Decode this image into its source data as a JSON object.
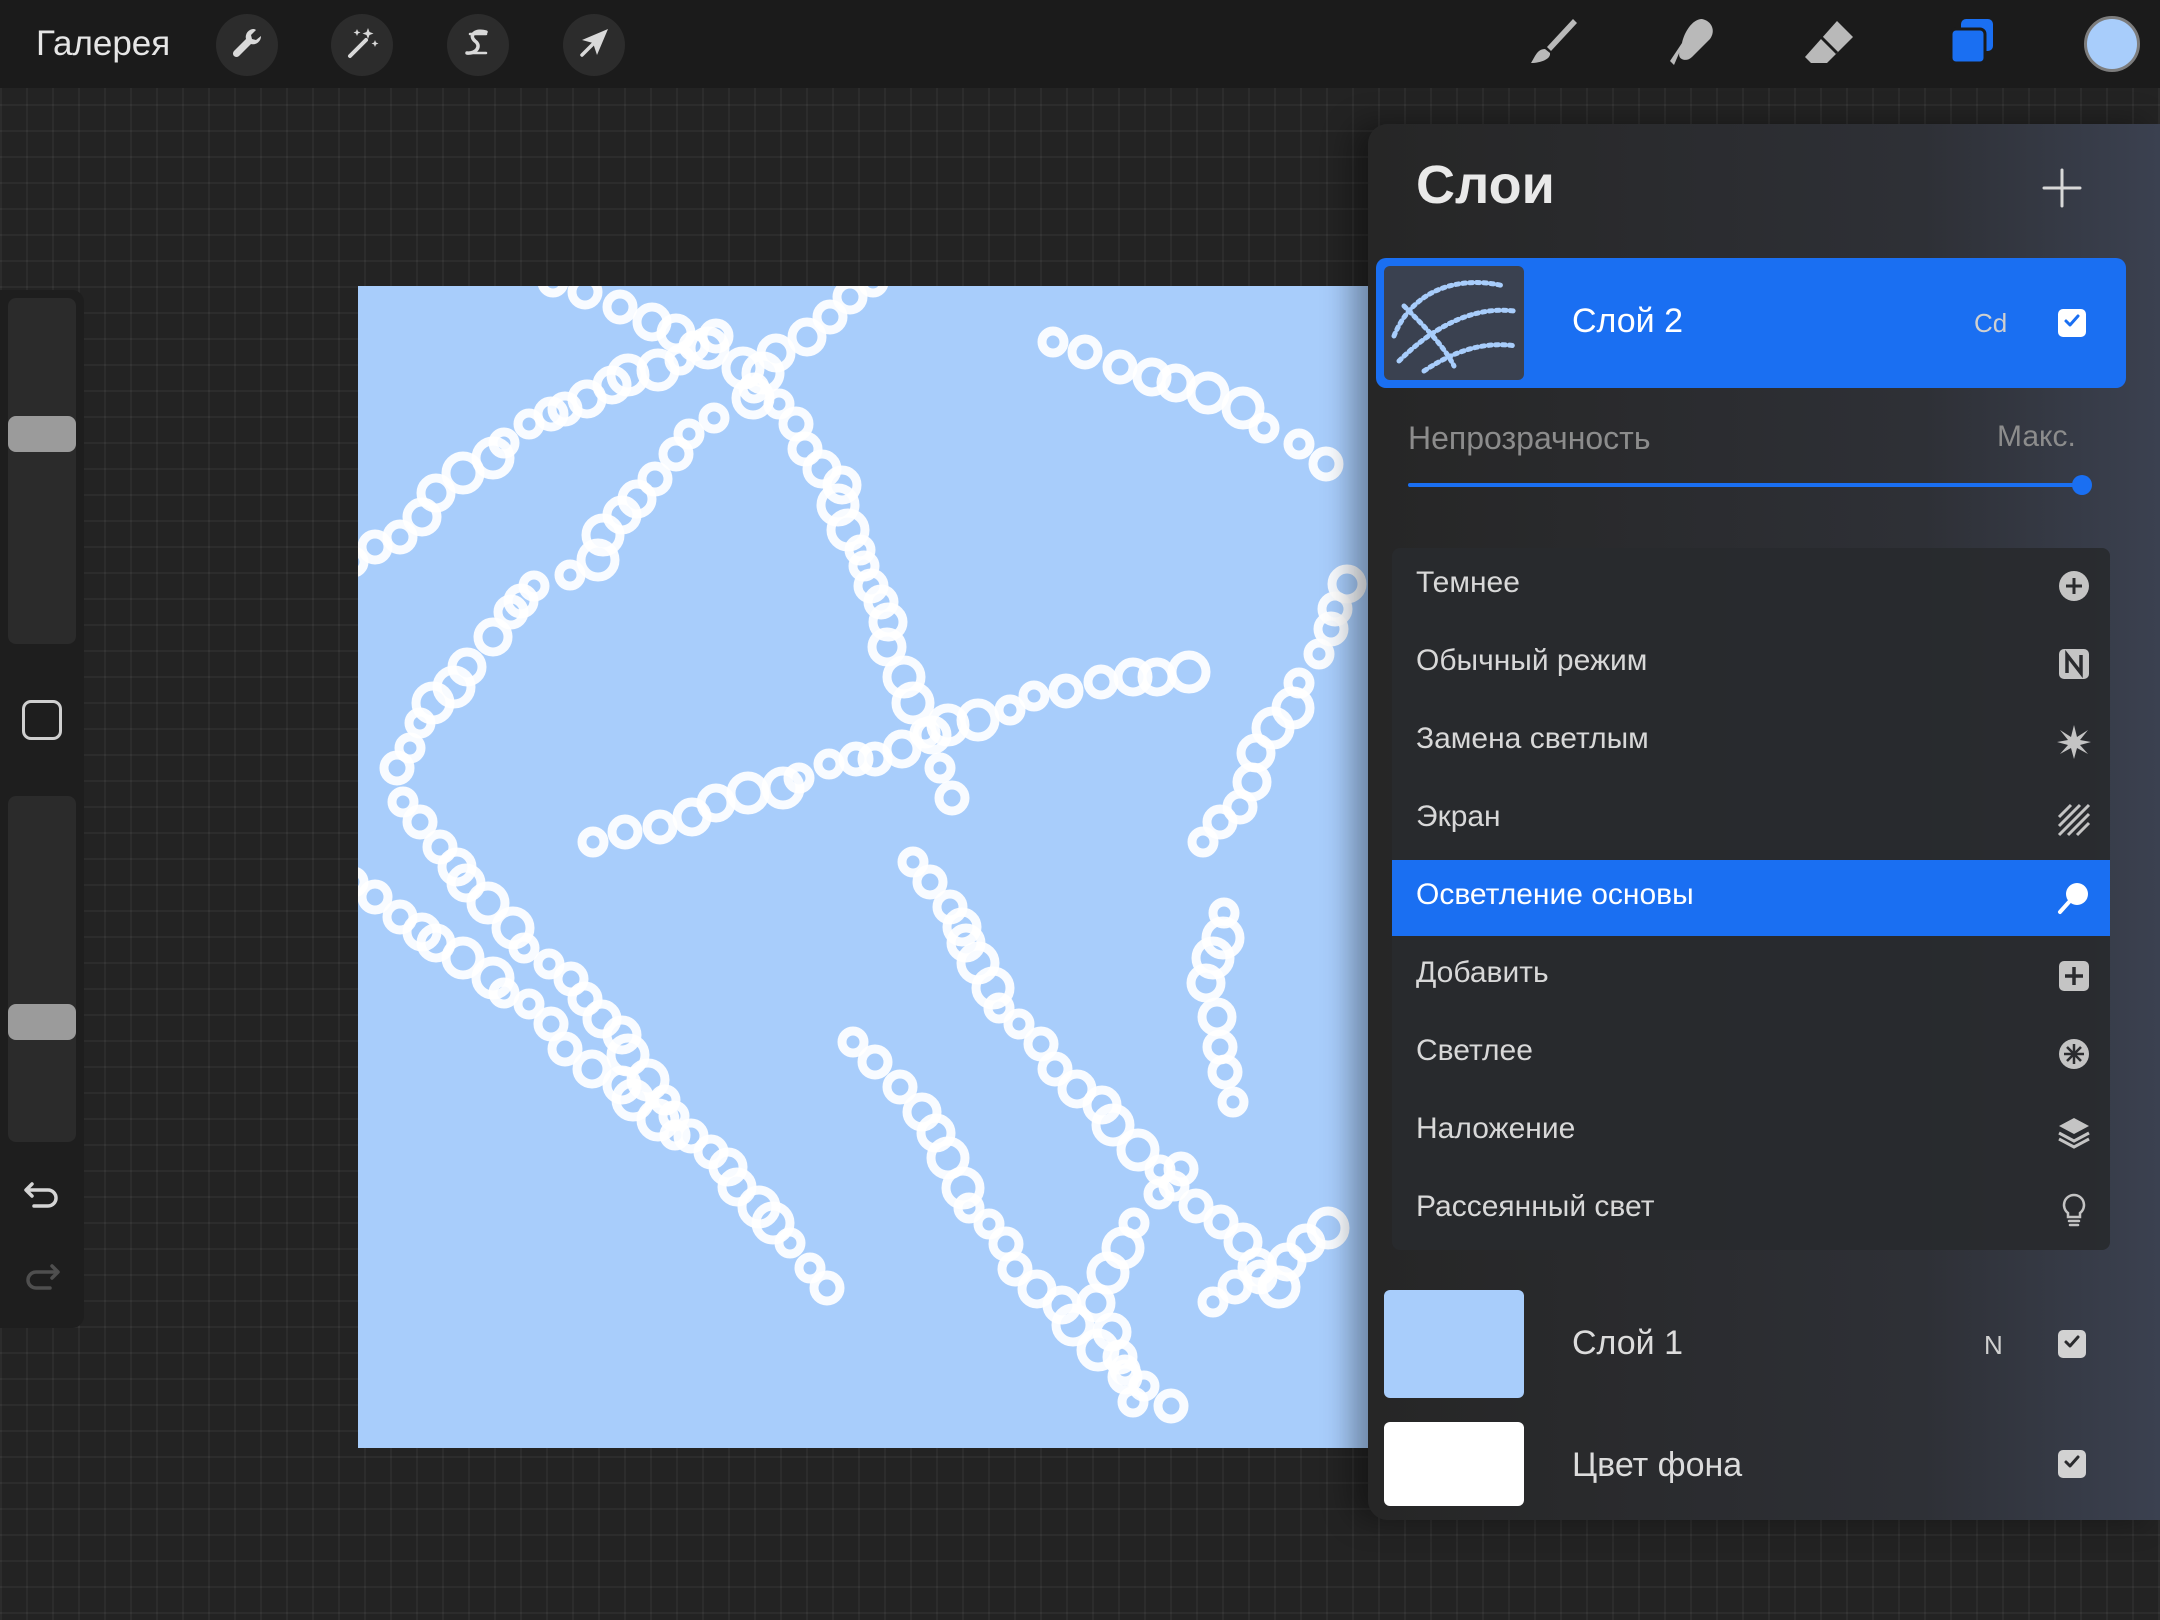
{
  "topbar": {
    "gallery_label": "Галерея",
    "left_tools": [
      {
        "name": "actions",
        "icon": "wrench-icon"
      },
      {
        "name": "adjustments",
        "icon": "magic-wand-icon"
      },
      {
        "name": "selection",
        "icon": "selection-s-icon"
      },
      {
        "name": "transform",
        "icon": "arrow-cursor-icon"
      }
    ],
    "right_tools": [
      {
        "name": "brush",
        "icon": "brush-icon"
      },
      {
        "name": "smudge",
        "icon": "smudge-finger-icon"
      },
      {
        "name": "eraser",
        "icon": "eraser-icon"
      },
      {
        "name": "layers",
        "icon": "layers-icon",
        "active": true
      }
    ],
    "current_color": "#a8cdfb"
  },
  "sidebar": {
    "brush_size_level": 0.62,
    "opacity_level": 0.33,
    "icons": [
      "modify-square-icon",
      "undo-icon",
      "redo-icon"
    ]
  },
  "canvas": {
    "background_color": "#a8cdfb",
    "stroke_color": "#ffffff"
  },
  "layers_panel": {
    "title": "Слои",
    "add_icon": "plus-icon",
    "layers": [
      {
        "name": "Слой 2",
        "mode": "Cd",
        "visible": true,
        "active": true
      },
      {
        "name": "Слой 1",
        "mode": "N",
        "visible": true,
        "active": false
      },
      {
        "name": "Цвет фона",
        "mode": "",
        "visible": true,
        "active": false
      }
    ],
    "opacity": {
      "label": "Непрозрачность",
      "value_label": "Макс.",
      "value": 1.0
    },
    "blend_modes": [
      {
        "label": "Темнее",
        "icon": "circle-plus-icon",
        "selected": false
      },
      {
        "label": "Обычный режим",
        "icon": "n-badge-icon",
        "selected": false
      },
      {
        "label": "Замена светлым",
        "icon": "starburst-icon",
        "selected": false
      },
      {
        "label": "Экран",
        "icon": "hatched-square-icon",
        "selected": false
      },
      {
        "label": "Осветление основы",
        "icon": "color-dodge-icon",
        "selected": true
      },
      {
        "label": "Добавить",
        "icon": "square-plus-icon",
        "selected": false
      },
      {
        "label": "Светлее",
        "icon": "circle-star-icon",
        "selected": false
      },
      {
        "label": "Наложение",
        "icon": "stack-icon",
        "selected": false
      },
      {
        "label": "Рассеянный свет",
        "icon": "lightbulb-icon",
        "selected": false
      }
    ]
  }
}
